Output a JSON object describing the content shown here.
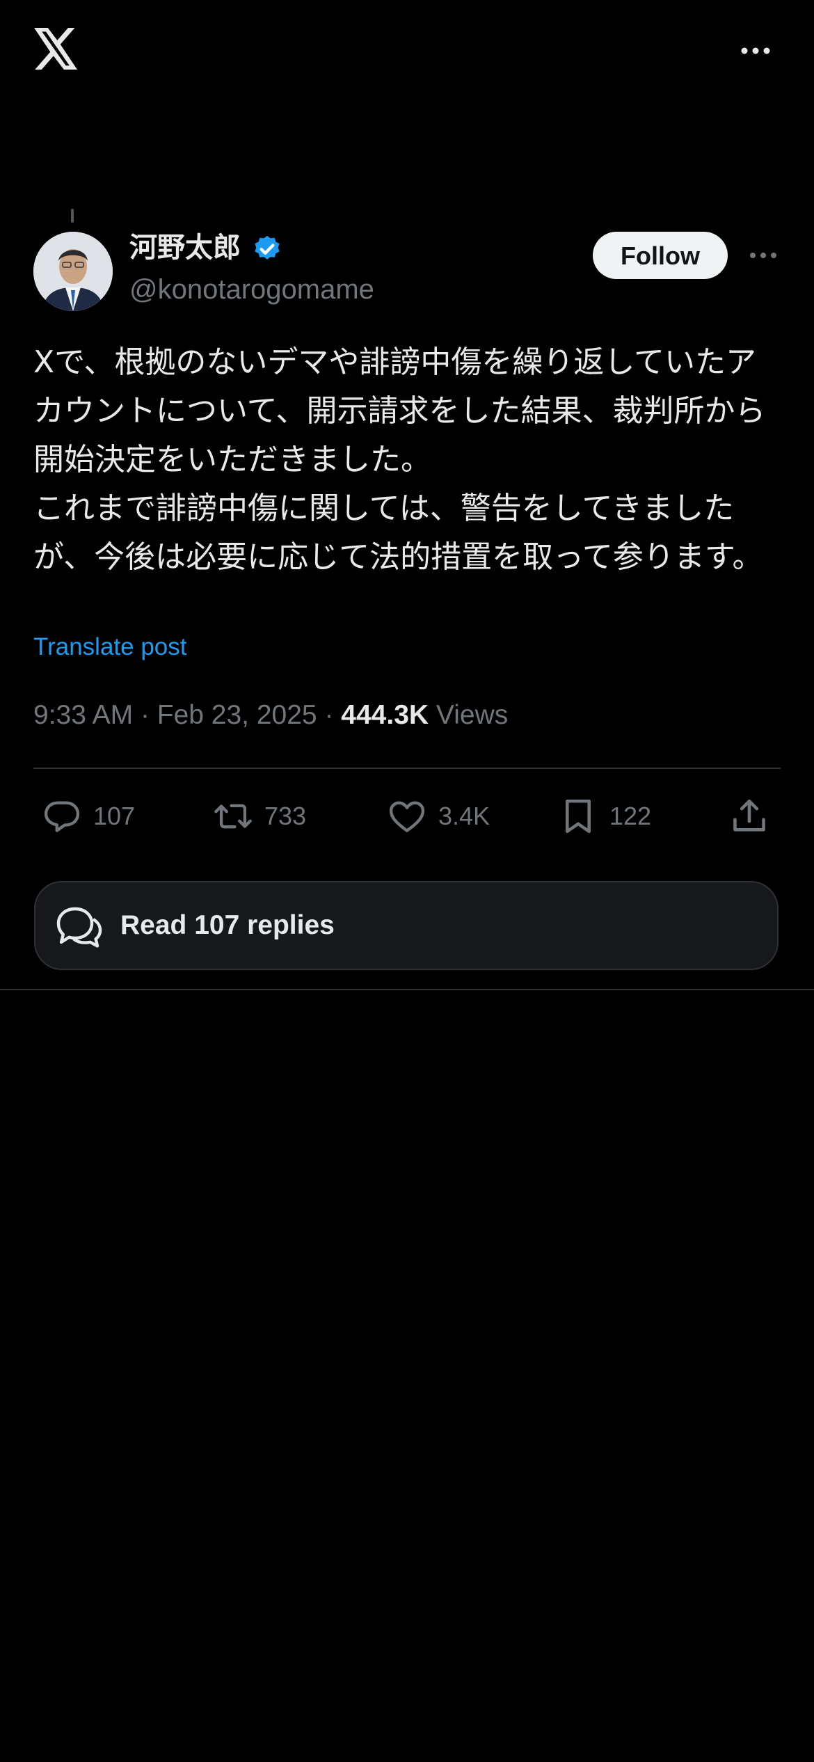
{
  "header": {
    "logo_icon": "x-logo-icon",
    "more_icon": "more-horizontal-icon"
  },
  "post": {
    "author_name": "河野太郎",
    "author_handle": "@konotarogomame",
    "follow_label": "Follow",
    "text": "Xで、根拠のないデマや誹謗中傷を繰り返していたアカウントについて、開示請求をした結果、裁判所から開始決定をいただきました。\nこれまで誹謗中傷に関しては、警告をしてきましたが、今後は必要に応じて法的措置を取って参ります。",
    "translate_label": "Translate post",
    "time": "9:33 AM",
    "date": "Feb 23, 2025",
    "views_count": "444.3K",
    "views_label": "Views"
  },
  "actions": {
    "replies": "107",
    "reposts": "733",
    "likes": "3.4K",
    "bookmarks": "122"
  },
  "read_replies_label": "Read 107 replies",
  "colors": {
    "accent": "#1d9bf0",
    "background": "#000000",
    "muted": "#71767b"
  }
}
